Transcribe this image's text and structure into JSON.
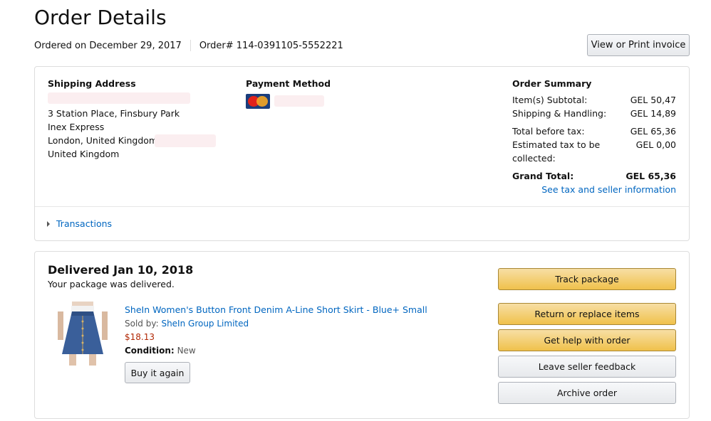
{
  "header": {
    "title": "Order Details",
    "ordered_on": "Ordered on December 29, 2017",
    "order_number": "Order# 114-0391105-5552221",
    "invoice_button": "View or Print invoice"
  },
  "shipping": {
    "title": "Shipping Address",
    "lines": [
      "3 Station Place, Finsbury Park",
      "Inex Express",
      "London, United Kingdom",
      "United Kingdom"
    ]
  },
  "payment": {
    "title": "Payment Method",
    "card_icon": "mastercard-icon"
  },
  "order_summary": {
    "title": "Order Summary",
    "rows": [
      {
        "label": "Item(s) Subtotal:",
        "value": "GEL 50,47"
      },
      {
        "label": "Shipping & Handling:",
        "value": "GEL 14,89"
      },
      {
        "label": "Total before tax:",
        "value": "GEL 65,36"
      },
      {
        "label": "Estimated tax to be",
        "label2": "collected:",
        "value": "GEL 0,00"
      }
    ],
    "grand_total_label": "Grand Total:",
    "grand_total_value": "GEL 65,36",
    "tax_link": "See tax and seller information"
  },
  "transactions": {
    "label": "Transactions"
  },
  "shipment": {
    "status_title": "Delivered Jan 10, 2018",
    "status_sub": "Your package was delivered.",
    "item": {
      "title": "SheIn Women's Button Front Denim A-Line Short Skirt - Blue+ Small",
      "sold_by_label": "Sold by:",
      "seller": "SheIn Group Limited",
      "price": "$18.13",
      "condition_label": "Condition:",
      "condition_value": "New",
      "buy_again": "Buy it again"
    },
    "actions": {
      "track": "Track package",
      "return": "Return or replace items",
      "help": "Get help with order",
      "feedback": "Leave seller feedback",
      "archive": "Archive order"
    }
  },
  "colors": {
    "link": "#0066c0",
    "price": "#b12704",
    "primary_button": "#f0c14b",
    "secondary_button": "#e7e9ec"
  }
}
